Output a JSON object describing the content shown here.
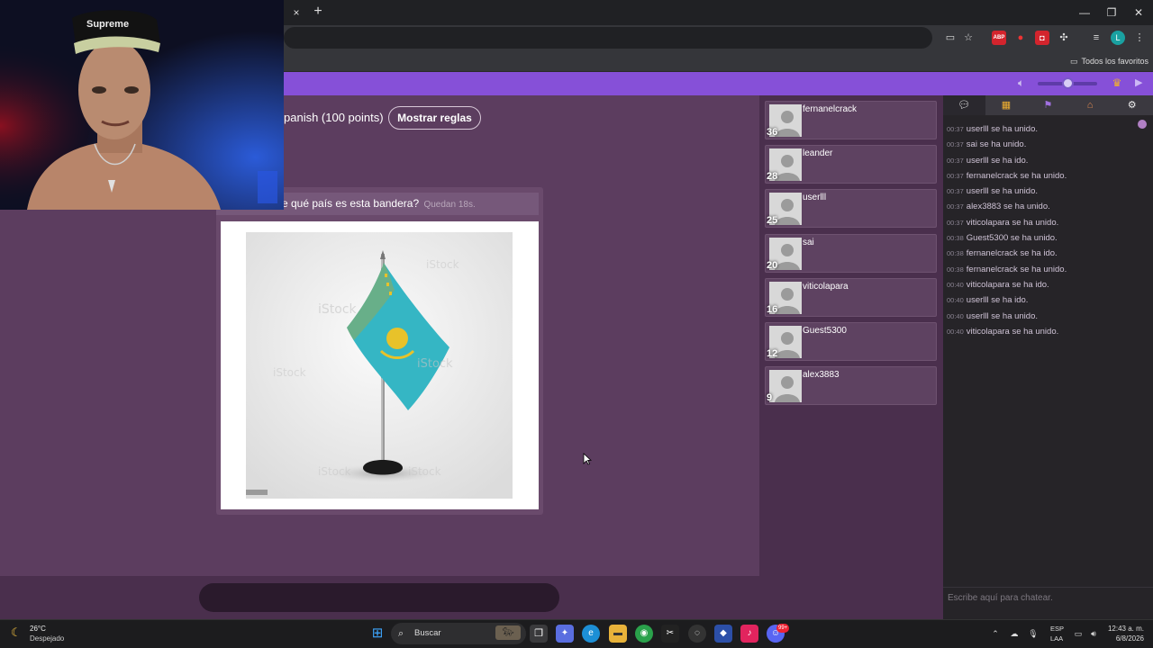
{
  "browser": {
    "tab_close": "×",
    "new_tab": "+",
    "window_buttons": {
      "minimize": "—",
      "restore": "❐",
      "close": "✕"
    },
    "toolbar_icons": {
      "abp": "ABP",
      "profile": "L"
    },
    "bookmarks_folder": "Todos los favoritos"
  },
  "game": {
    "rules_text": "panish (100 points)",
    "rules_button": "Mostrar reglas",
    "question": "e qué país es esta bandera?",
    "timer": "Quedan 18s.",
    "answer_placeholder": ""
  },
  "players": [
    {
      "name": "fernanelcrack",
      "score": "36"
    },
    {
      "name": "leander",
      "score": "28"
    },
    {
      "name": "userlll",
      "score": "25"
    },
    {
      "name": "sai",
      "score": "20"
    },
    {
      "name": "viticolapara",
      "score": "16"
    },
    {
      "name": "Guest5300",
      "score": "12"
    },
    {
      "name": "alex3883",
      "score": "9"
    }
  ],
  "chat": {
    "tabs": [
      "chat-icon",
      "trophy-icon",
      "user-icon",
      "podium-icon",
      "settings-icon"
    ],
    "messages": [
      {
        "time": "00:37",
        "text": "userlll se ha unido."
      },
      {
        "time": "00:37",
        "text": "sai se ha unido."
      },
      {
        "time": "00:37",
        "text": "userlll se ha ido."
      },
      {
        "time": "00:37",
        "text": "fernanelcrack se ha unido."
      },
      {
        "time": "00:37",
        "text": "userlll se ha unido."
      },
      {
        "time": "00:37",
        "text": "alex3883 se ha unido."
      },
      {
        "time": "00:37",
        "text": "viticolapara se ha unido."
      },
      {
        "time": "00:38",
        "text": "Guest5300 se ha unido."
      },
      {
        "time": "00:38",
        "text": "fernanelcrack se ha ido."
      },
      {
        "time": "00:38",
        "text": "fernanelcrack se ha unido."
      },
      {
        "time": "00:40",
        "text": "viticolapara se ha ido."
      },
      {
        "time": "00:40",
        "text": "userlll se ha ido."
      },
      {
        "time": "00:40",
        "text": "userlll se ha unido."
      },
      {
        "time": "00:40",
        "text": "viticolapara se ha unido."
      }
    ],
    "input_placeholder": "Escribe aquí para chatear."
  },
  "webcam": {
    "cap_text": "Supreme"
  },
  "taskbar": {
    "weather_temp": "26°C",
    "weather_cond": "Despejado",
    "search_label": "Buscar",
    "lang_top": "ESP",
    "lang_bottom": "LAA",
    "clock_time": "12:43 a. m.",
    "clock_date": "6/8/2026",
    "discord_badge": "99+"
  },
  "colors": {
    "site_purple": "#8650d8",
    "game_bg": "#5c3d5f",
    "panel_bg": "#4a2f4d",
    "flag_blue": "#35b6c4",
    "flag_gold": "#e8c22a"
  }
}
